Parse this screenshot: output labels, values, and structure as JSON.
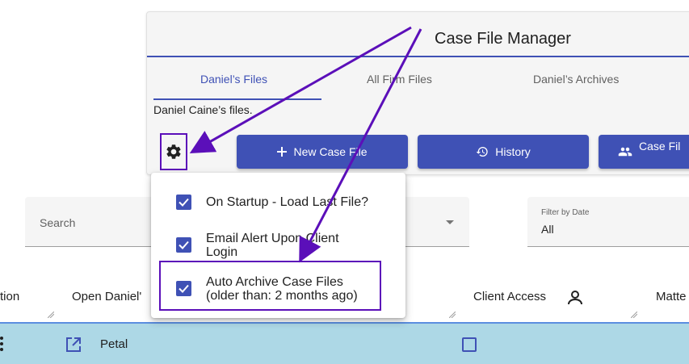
{
  "panel": {
    "title": "Case File Manager",
    "tabs": [
      {
        "label": "Daniel’s Files",
        "active": true
      },
      {
        "label": "All Firm Files",
        "active": false
      },
      {
        "label": "Daniel’s Archives",
        "active": false
      }
    ],
    "subtitle": "Daniel Caine’s files.",
    "buttons": {
      "new_case": "New Case File",
      "history": "History",
      "case_files": "Case Fil"
    }
  },
  "settings_menu": {
    "items": [
      {
        "line1": "On Startup - Load Last File?",
        "line2": "",
        "checked": true
      },
      {
        "line1": "Email Alert Upon Client",
        "line2": "Login",
        "checked": true
      },
      {
        "line1": "Auto Archive Case Files",
        "line2": "(older than: 2 months ago)",
        "checked": true
      }
    ]
  },
  "search": {
    "label": "Search"
  },
  "filter": {
    "label": "Filter by Date",
    "value": "All"
  },
  "table": {
    "columns": [
      "tion",
      "Open Daniel'",
      "Client Access",
      "Matte"
    ],
    "rows": [
      {
        "name": "Petal",
        "client_access": false
      }
    ]
  },
  "colors": {
    "primary": "#3f51b5",
    "annotation": "#5b0fb9",
    "row_highlight": "#add8e6"
  }
}
